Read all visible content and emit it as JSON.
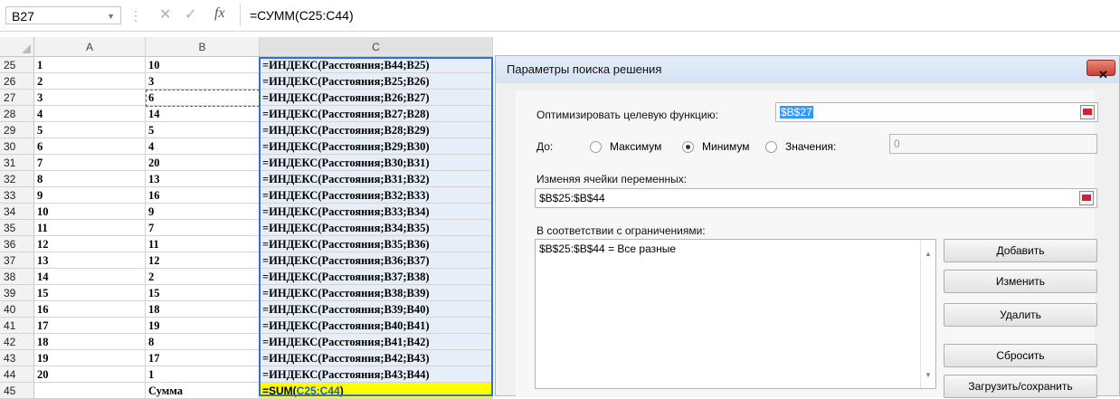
{
  "formula_bar": {
    "name_box": "B27",
    "cancel_glyph": "✕",
    "enter_glyph": "✓",
    "fx_label": "fx",
    "formula": "=СУММ(C25:C44)"
  },
  "columns": [
    "A",
    "B",
    "C"
  ],
  "rows": [
    {
      "num": "25",
      "a": "1",
      "b": "10",
      "c": "=ИНДЕКС(Расстояния;B44;B25)"
    },
    {
      "num": "26",
      "a": "2",
      "b": "3",
      "c": "=ИНДЕКС(Расстояния;B25;B26)"
    },
    {
      "num": "27",
      "a": "3",
      "b": "6",
      "c": "=ИНДЕКС(Расстояния;B26;B27)"
    },
    {
      "num": "28",
      "a": "4",
      "b": "14",
      "c": "=ИНДЕКС(Расстояния;B27;B28)"
    },
    {
      "num": "29",
      "a": "5",
      "b": "5",
      "c": "=ИНДЕКС(Расстояния;B28;B29)"
    },
    {
      "num": "30",
      "a": "6",
      "b": "4",
      "c": "=ИНДЕКС(Расстояния;B29;B30)"
    },
    {
      "num": "31",
      "a": "7",
      "b": "20",
      "c": "=ИНДЕКС(Расстояния;B30;B31)"
    },
    {
      "num": "32",
      "a": "8",
      "b": "13",
      "c": "=ИНДЕКС(Расстояния;B31;B32)"
    },
    {
      "num": "33",
      "a": "9",
      "b": "16",
      "c": "=ИНДЕКС(Расстояния;B32;B33)"
    },
    {
      "num": "34",
      "a": "10",
      "b": "9",
      "c": "=ИНДЕКС(Расстояния;B33;B34)"
    },
    {
      "num": "35",
      "a": "11",
      "b": "7",
      "c": "=ИНДЕКС(Расстояния;B34;B35)"
    },
    {
      "num": "36",
      "a": "12",
      "b": "11",
      "c": "=ИНДЕКС(Расстояния;B35;B36)"
    },
    {
      "num": "37",
      "a": "13",
      "b": "12",
      "c": "=ИНДЕКС(Расстояния;B36;B37)"
    },
    {
      "num": "38",
      "a": "14",
      "b": "2",
      "c": "=ИНДЕКС(Расстояния;B37;B38)"
    },
    {
      "num": "39",
      "a": "15",
      "b": "15",
      "c": "=ИНДЕКС(Расстояния;B38;B39)"
    },
    {
      "num": "40",
      "a": "16",
      "b": "18",
      "c": "=ИНДЕКС(Расстояния;B39;B40)"
    },
    {
      "num": "41",
      "a": "17",
      "b": "19",
      "c": "=ИНДЕКС(Расстояния;B40;B41)"
    },
    {
      "num": "42",
      "a": "18",
      "b": "8",
      "c": "=ИНДЕКС(Расстояния;B41;B42)"
    },
    {
      "num": "43",
      "a": "19",
      "b": "17",
      "c": "=ИНДЕКС(Расстояния;B42;B43)"
    },
    {
      "num": "44",
      "a": "20",
      "b": "1",
      "c": "=ИНДЕКС(Расстояния;B43;B44)"
    }
  ],
  "sum_row": {
    "num": "45",
    "a": "",
    "b": "Сумма",
    "c_prefix": "=SUM(",
    "c_ref": "C25:C44",
    "c_suffix": ")"
  },
  "dialog": {
    "title": "Параметры поиска решения",
    "close_glyph": "✕",
    "objective_label": "Оптимизировать целевую функцию:",
    "objective_value": "$B$27",
    "to_label": "До:",
    "opt_max": "Максимум",
    "opt_min": "Минимум",
    "opt_value": "Значения:",
    "value_field": "0",
    "changing_label": "Изменяя ячейки переменных:",
    "changing_value": "$B$25:$B$44",
    "constraints_label": "В соответствии с ограничениями:",
    "constraints": [
      "$B$25:$B$44 = Все разные"
    ],
    "buttons": {
      "add": "Добавить",
      "change": "Изменить",
      "delete": "Удалить",
      "reset": "Сбросить",
      "load_save": "Загрузить/сохранить"
    }
  },
  "colors": {
    "selection": "#2f6fd8",
    "sum_fill": "#ffff00",
    "formula_column_fill": "#e6eef8"
  }
}
